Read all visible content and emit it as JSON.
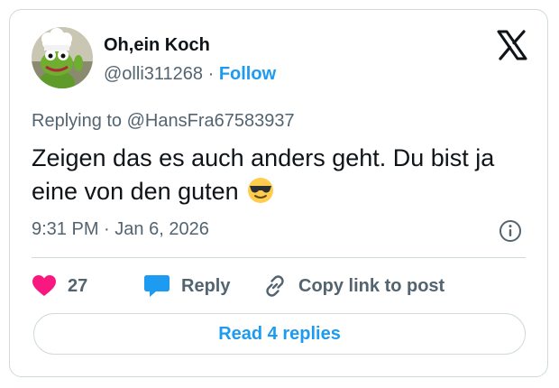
{
  "tweet": {
    "author": {
      "display_name": "Oh,ein Koch",
      "handle": "@olli311268",
      "separator": "·",
      "follow_label": "Follow",
      "avatar_icon": "chef-frog-avatar"
    },
    "reply_context": "Replying to @HansFra67583937",
    "text": "Zeigen das es auch anders geht. Du bist ja eine von den guten",
    "emoji": "sunglasses-emoji",
    "time": "9:31 PM",
    "date_separator": "·",
    "date": "Jan 6, 2026"
  },
  "actions": {
    "like_count": "27",
    "reply_label": "Reply",
    "copy_label": "Copy link to post"
  },
  "read_replies_label": "Read 4 replies",
  "colors": {
    "accent": "#1d9bf0",
    "like": "#f91880",
    "text": "#0f1419",
    "muted": "#536471",
    "border": "#cfd9de"
  }
}
